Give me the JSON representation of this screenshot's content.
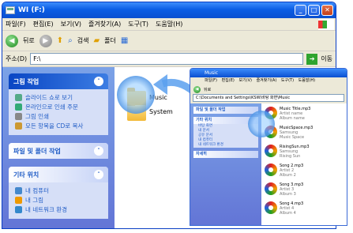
{
  "window": {
    "title": "WI (F:)",
    "buttons": [
      "_",
      "□",
      "✕"
    ]
  },
  "menu": [
    "파일(F)",
    "편집(E)",
    "보기(V)",
    "즐겨찾기(A)",
    "도구(T)",
    "도움말(H)"
  ],
  "toolbar": {
    "back": "뒤로",
    "search": "검색",
    "folders": "폴더"
  },
  "address": {
    "label": "주소(D)",
    "value": "F:\\",
    "go": "이동"
  },
  "tasks": {
    "picture_tasks": {
      "title": "그림 작업",
      "items": [
        "슬라이드 쇼로 보기",
        "온라인으로 인쇄 주문",
        "그림 인쇄",
        "모든 항목을 CD로 복사"
      ]
    },
    "file_tasks": {
      "title": "파일 및 폴더 작업"
    },
    "other_places": {
      "title": "기타 위치",
      "items": [
        "내 컴퓨터",
        "내 그림",
        "내 네트워크 환경"
      ]
    }
  },
  "files": [
    {
      "name": "Music"
    },
    {
      "name": "System"
    }
  ],
  "overlay": {
    "title": "Music",
    "menu": [
      "파일(F)",
      "편집(E)",
      "보기(V)",
      "즐겨찾기(A)",
      "도구(T)",
      "도움말(H)"
    ],
    "toolbar_back": "뒤로",
    "address": "C:\\Documents and Settings\\KSW\\바탕 화면\\Music",
    "tasks": {
      "file_tasks": "파일 및 폴더 작업",
      "other_places": "기타 위치",
      "other_items": [
        "바탕 화면",
        "내 문서",
        "공유 문서",
        "내 컴퓨터",
        "내 네트워크 환경"
      ],
      "details": "자세히"
    },
    "songs": [
      {
        "title": "Music Title.mp3",
        "artist": "Artist name",
        "album": "Album name"
      },
      {
        "title": "MusicSpace.mp3",
        "artist": "Samsung",
        "album": "Music Space"
      },
      {
        "title": "RisingSun.mp3",
        "artist": "Samsung",
        "album": "Rising Sun"
      },
      {
        "title": "Song 2.mp3",
        "artist": "Artist 2",
        "album": "Album 2"
      },
      {
        "title": "Song 3.mp3",
        "artist": "Artist 3",
        "album": "Album 3"
      },
      {
        "title": "Song 4.mp3",
        "artist": "Artist 4",
        "album": "Album 4"
      }
    ]
  }
}
